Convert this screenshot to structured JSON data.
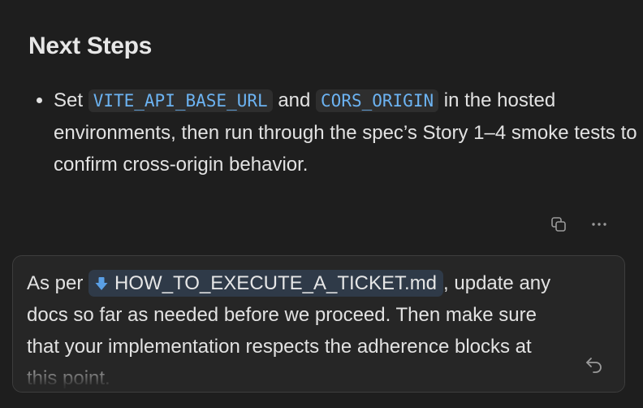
{
  "message": {
    "heading": "Next Steps",
    "step": {
      "prefix": "Set",
      "code_1": "VITE_API_BASE_URL",
      "middle": "and",
      "code_2": "CORS_ORIGIN",
      "suffix": "in the hosted environments, then run through the spec’s Story 1–4 smoke tests to confirm cross-origin behavior."
    }
  },
  "toolbar": {
    "copy_icon": "copy-icon",
    "more_icon": "more-options-icon"
  },
  "composer": {
    "text_before": "As per",
    "file_chip_icon": "arrow-down-icon",
    "file_chip_label": "HOW_TO_EXECUTE_A_TICKET.md",
    "text_after": ", update any docs so far as needed before we proceed. Then make sure that your implementation respects the adherence blocks at this point.",
    "send_icon": "undo-icon"
  },
  "colors": {
    "background": "#1e1e1e",
    "code_text": "#6cb3f2",
    "code_background": "#2e2e2e",
    "file_chip_background": "#2f3a48",
    "file_chip_icon": "#5aa0e6",
    "composer_background": "#262626",
    "composer_border": "#3d3d3d"
  }
}
